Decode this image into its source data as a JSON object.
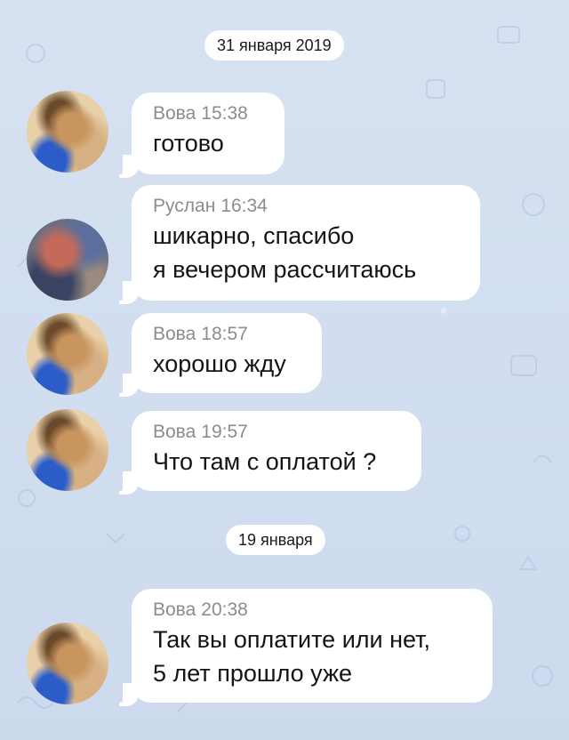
{
  "dates": [
    "31 января 2019",
    "19 января"
  ],
  "messages": [
    {
      "author": "Вова",
      "time": "15:38",
      "lines": [
        "готово"
      ]
    },
    {
      "author": "Руслан",
      "time": "16:34",
      "lines": [
        "шикарно, спасибо",
        "я вечером рассчитаюсь"
      ]
    },
    {
      "author": "Вова",
      "time": "18:57",
      "lines": [
        "хорошо жду"
      ]
    },
    {
      "author": "Вова",
      "time": "19:57",
      "lines": [
        "Что там с оплатой ?"
      ]
    },
    {
      "author": "Вова",
      "time": "20:38",
      "lines": [
        "Так вы оплатите или нет,",
        "5 лет прошло уже"
      ]
    }
  ],
  "colors": {
    "background": "#cfdcef",
    "bubble": "#ffffff",
    "meta_text": "#8c8c8c",
    "message_text": "#141414"
  }
}
